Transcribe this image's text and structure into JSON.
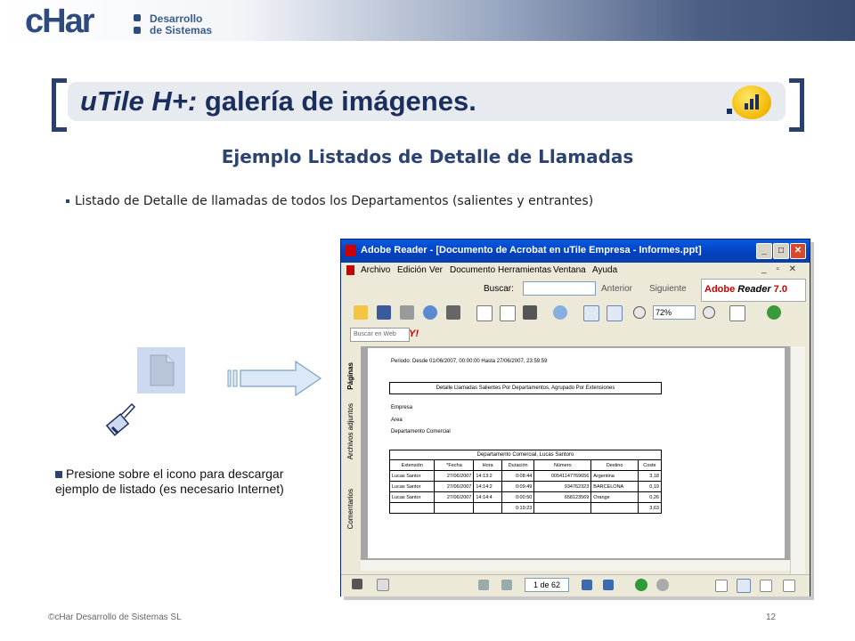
{
  "logo": {
    "name": "cHar",
    "line1": "Desarrollo",
    "line2": "de Sistemas"
  },
  "title": {
    "product": "uTile H+:",
    "rest": " galería de imágenes."
  },
  "subtitle": "Ejemplo Listados de Detalle de Llamadas",
  "bullet": "Listado de Detalle de llamadas de todos los Departamentos (salientes y entrantes)",
  "press_text": "Presione sobre el icono para descargar  ejemplo de listado (es necesario Internet)",
  "adobe": {
    "title": "Adobe Reader - [Documento de Acrobat en uTile Empresa - Informes.ppt]",
    "menu": [
      "Archivo",
      "Edición",
      "Ver",
      "Documento",
      "Herramientas",
      "Ventana",
      "Ayuda"
    ],
    "buscar_label": "Buscar:",
    "anterior": "Anterior",
    "siguiente": "Siguiente",
    "brand": "Adobe",
    "brand_product": "Reader",
    "brand_version": "7.0",
    "zoom": "72%",
    "buscar_web": "Buscar en Web",
    "yahoo": "Y!",
    "side_tabs": [
      "Páginas",
      "Archivos adjuntos",
      "Comentarios"
    ],
    "page_indicator": "1 de 62",
    "document": {
      "periodo": "Periodo: Desde 01/06/2007, 00:00:00 Hasta 27/06/2007, 23:59:59",
      "header_box": "Detalle Llamadas Salientes Por Departamentos, Agrupado Por Extensiones",
      "empresa": "Empresa",
      "area": "Area",
      "departamento": "Departamento Comercial",
      "table_title": "Departamento Comercial, Lucas Santoro",
      "columns": [
        "Extensión",
        "*Fecha",
        "Hora",
        "Duración",
        "Número",
        "Destino",
        "Coste"
      ],
      "rows": [
        [
          "Lucas Santor",
          "27/06/2007",
          "14:13:2",
          "0:08:44",
          "00541147769656",
          "Argentina",
          "3,18"
        ],
        [
          "Lucas Santor",
          "27/06/2007",
          "14:14:2",
          "0:09:49",
          "934762323",
          "BARCELONA",
          "0,19"
        ],
        [
          "Lucas Santor",
          "27/06/2007",
          "14:14:4",
          "0:00:50",
          "658123569",
          "Orange",
          "0,26"
        ]
      ],
      "total_duration": "0:19:23",
      "total_cost": "3,63"
    }
  },
  "footer": {
    "left": "©cHar Desarrollo de Sistemas SL",
    "right": "12"
  }
}
